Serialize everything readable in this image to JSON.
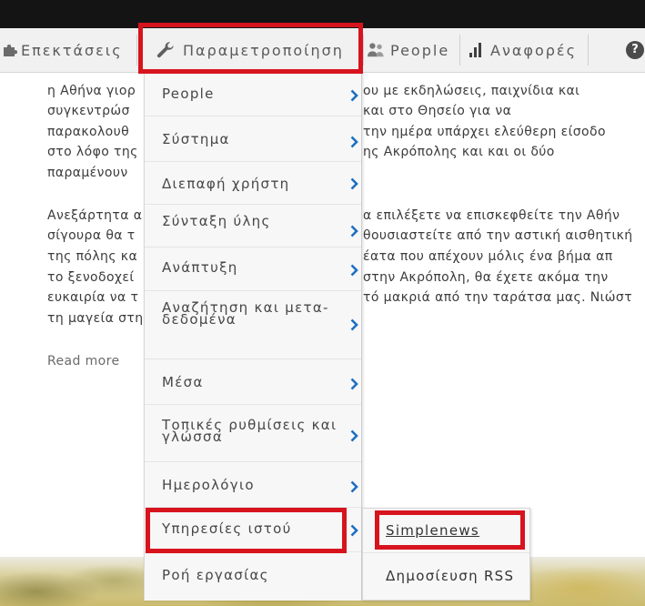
{
  "toolbar": {
    "items": [
      {
        "label": "Επεκτάσεις",
        "icon": "puzzle-icon"
      },
      {
        "label": "Παραμετροποίηση",
        "icon": "wrench-icon",
        "highlighted": true
      },
      {
        "label": "People",
        "icon": "people-icon"
      },
      {
        "label": "Αναφορές",
        "icon": "bar-chart-icon"
      }
    ],
    "help": {
      "icon": "help-icon",
      "glyph": "?"
    }
  },
  "menu": {
    "submenu_indicator_icon": "chevron-right-icon",
    "items": [
      {
        "label": "People",
        "has_submenu": true
      },
      {
        "label": "Σύστημα",
        "has_submenu": true
      },
      {
        "label": "Διεπαφή χρήστη",
        "has_submenu": true
      },
      {
        "label": "Σύνταξη ύλης",
        "has_submenu": true
      },
      {
        "label": "Ανάπτυξη",
        "has_submenu": true
      },
      {
        "label": "Αναζήτηση και μετα-δεδομένα",
        "has_submenu": true
      },
      {
        "label": "Μέσα",
        "has_submenu": true
      },
      {
        "label": "Τοπικές ρυθμίσεις και γλώσσα",
        "has_submenu": true
      },
      {
        "label": "Ημερολόγιο",
        "has_submenu": true
      },
      {
        "label": "Υπηρεσίες ιστού",
        "has_submenu": true,
        "highlighted": true
      },
      {
        "label": "Ροή εργασίας",
        "has_submenu": false
      }
    ]
  },
  "submenu": {
    "items": [
      {
        "label": "Simplenews",
        "highlighted": true
      },
      {
        "label": "Δημοσίευση RSS"
      }
    ]
  },
  "content": {
    "left_lines": [
      "η Αθήνα γιορ",
      "συγκεντρώσ",
      "παρακολουθ",
      "στο λόφο της",
      "παραμένουν",
      "Ανεξάρτητα α",
      "σίγουρα θα τ",
      "της πόλης κα",
      "το ξενοδοχεί",
      "ευκαιρία να τ",
      "τη μαγεία στη"
    ],
    "right_lines": [
      "ου με εκδηλώσεις, παιχνίδια και",
      "και στο Θησείο για να",
      "την ημέρα υπάρχει ελεύθερη είσοδο",
      "ης Ακρόπολης και και οι δύο",
      "α επιλέξετε να επισκεφθείτε την Αθήν",
      "θουσιαστείτε από την αστική αισθητική",
      "έατα που απέχουν μόλις ένα βήμα απ",
      "στην Ακρόπολη, θα έχετε ακόμα την",
      "τό μακριά από την ταράτσα μας. Νιώστ"
    ],
    "read_more": "Read more"
  },
  "colors": {
    "top_bar": "#141414",
    "toolbar_bg": "#f1f1f1",
    "toolbar_text": "#5a5a5a",
    "menu_bg": "#f7f7f7",
    "menu_text": "#474747",
    "chevron": "#1d6fc0",
    "highlight": "#d7141e",
    "page_text": "#3b3b3b",
    "read_more": "#6b6b6b"
  }
}
